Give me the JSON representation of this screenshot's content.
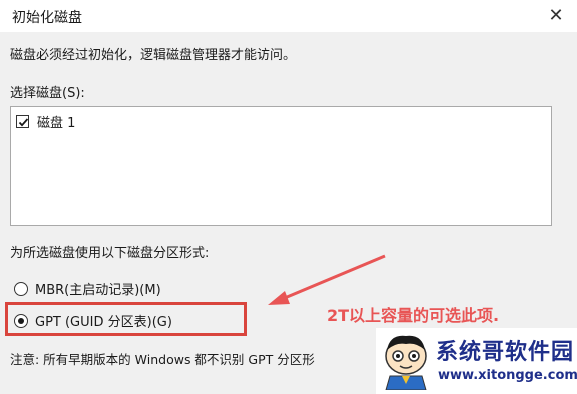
{
  "window": {
    "title": "初始化磁盘",
    "close_glyph": "✕"
  },
  "message": "磁盘必须经过初始化，逻辑磁盘管理器才能访问。",
  "select_disk": {
    "label": "选择磁盘(S):",
    "items": [
      {
        "label": "磁盘 1",
        "checked": true
      }
    ]
  },
  "partition_style": {
    "label": "为所选磁盘使用以下磁盘分区形式:",
    "options": [
      {
        "label": "MBR(主启动记录)(M)",
        "selected": false
      },
      {
        "label": "GPT (GUID 分区表)(G)",
        "selected": true
      }
    ]
  },
  "note": "注意: 所有早期版本的 Windows 都不识别 GPT 分区形",
  "annotation": {
    "text": "2T以上容量的可选此项.",
    "color": "#e85555"
  },
  "watermark": {
    "name": "系统哥软件园",
    "url": "www.xitongge.com",
    "color": "#1f2f8a"
  },
  "colors": {
    "highlight": "#d9453d",
    "dialog_bg": "#f0f0f0"
  }
}
